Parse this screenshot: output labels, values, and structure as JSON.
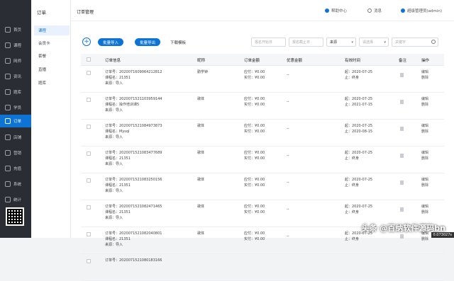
{
  "sidebar": {
    "items": [
      {
        "label": "首页",
        "icon": "home-icon"
      },
      {
        "label": "课程",
        "icon": "book-icon"
      },
      {
        "label": "网师",
        "icon": "teacher-icon"
      },
      {
        "label": "资讯",
        "icon": "news-icon"
      },
      {
        "label": "题库",
        "icon": "quiz-icon"
      },
      {
        "label": "学员",
        "icon": "student-icon"
      },
      {
        "label": "订单",
        "icon": "order-icon"
      },
      {
        "label": "店铺",
        "icon": "shop-icon"
      },
      {
        "label": "营销",
        "icon": "marketing-icon"
      },
      {
        "label": "充值",
        "icon": "recharge-icon"
      },
      {
        "label": "系统",
        "icon": "system-icon"
      },
      {
        "label": "统计",
        "icon": "stats-icon"
      }
    ],
    "active_index": 6
  },
  "submenu": {
    "title": "订单",
    "items": [
      "课程",
      "会员卡",
      "套餐",
      "直播",
      "题库"
    ],
    "active_index": 0
  },
  "header": {
    "title": "订单管理",
    "help": "帮助中心",
    "messages": "消息",
    "user": "超级管理员(admin)"
  },
  "toolbar": {
    "add": "+",
    "batch_import": "批量导入",
    "batch_export": "批量导出",
    "download_template": "下载模板",
    "start_date_placeholder": "报名开始日",
    "end_date_placeholder": "报名截止日",
    "source_select": "来源",
    "status_select": "请选择",
    "keyword_placeholder": "关键字"
  },
  "table": {
    "headers": [
      "订单信息",
      "昵称",
      "订单金额",
      "优惠金额",
      "有效时间",
      "备注",
      "操作"
    ],
    "rows": [
      {
        "order_no": "订单号：2020071609064212812",
        "course": "课程名：21351",
        "source": "来源：导入",
        "nick": "勤学钟",
        "due": "应付：¥0.00",
        "paid": "实付：¥0.00",
        "discount": "--",
        "start": "起：2020-07-25",
        "end": "止：终身",
        "edit": "编辑",
        "del": "删除"
      },
      {
        "order_no": "订单号：2020071521103959144",
        "course": "课程名：操作培训课5",
        "source": "来源：导入",
        "nick": "歌体",
        "due": "应付：¥0.00",
        "paid": "实付：¥0.00",
        "discount": "--",
        "start": "起：2020-07-25",
        "end": "止：2021-07-15",
        "edit": "编辑",
        "del": "删除"
      },
      {
        "order_no": "订单号：2020071521084973873",
        "course": "课程名：Mysql",
        "source": "来源：导入",
        "nick": "歌体",
        "due": "应付：¥0.00",
        "paid": "实付：¥0.00",
        "discount": "--",
        "start": "起：2020-07-25",
        "end": "止：2020-08-15",
        "edit": "编辑",
        "del": "删除"
      },
      {
        "order_no": "订单号：2020071521083477689",
        "course": "课程名：21351",
        "source": "来源：导入",
        "nick": "歌体",
        "due": "应付：¥0.00",
        "paid": "实付：¥0.00",
        "discount": "--",
        "start": "起：2020-07-25",
        "end": "止：终身",
        "edit": "编辑",
        "del": "删除"
      },
      {
        "order_no": "订单号：2020071521083250156",
        "course": "课程名：21351",
        "source": "来源：导入",
        "nick": "歌体",
        "due": "应付：¥0.00",
        "paid": "实付：¥0.00",
        "discount": "--",
        "start": "起：2020-07-25",
        "end": "止：终身",
        "edit": "编辑",
        "del": "删除"
      },
      {
        "order_no": "订单号：2020071521082471465",
        "course": "课程名：21351",
        "source": "来源：导入",
        "nick": "歌体",
        "due": "应付：¥0.00",
        "paid": "实付：¥0.00",
        "discount": "--",
        "start": "起：2020-07-25",
        "end": "止：终身",
        "edit": "编辑",
        "del": "删除"
      },
      {
        "order_no": "订单号：2020071521082040801",
        "course": "课程名：21351",
        "source": "来源：导入",
        "nick": "歌体",
        "due": "应付：¥0.00",
        "paid": "实付：¥0.00",
        "discount": "--",
        "start": "起：2020-07-25",
        "end": "止：终身",
        "edit": "编辑",
        "del": "删除"
      },
      {
        "order_no": "订单号：2020071521080183166",
        "course": "",
        "source": "",
        "nick": "",
        "due": "",
        "paid": "",
        "discount": "",
        "start": "",
        "end": "",
        "edit": "",
        "del": ""
      }
    ]
  },
  "watermark": "头条 @百纳软件源码bn",
  "corner_badge": "0.073027s"
}
